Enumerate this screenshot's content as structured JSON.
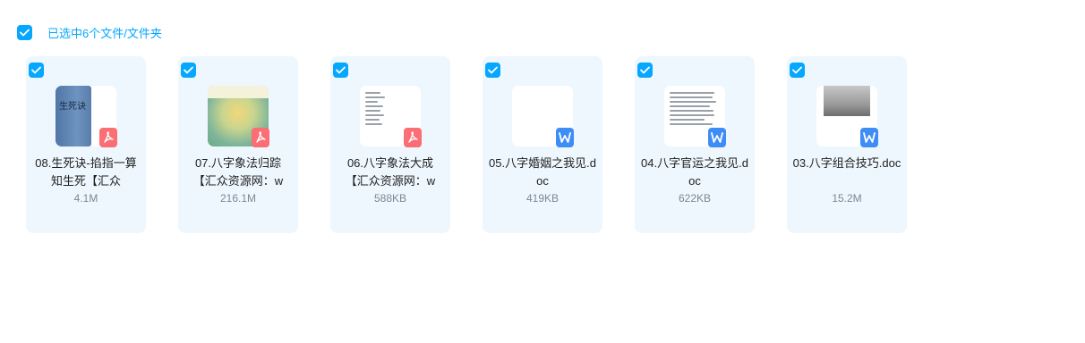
{
  "selection": {
    "text": "已选中6个文件/文件夹"
  },
  "files": [
    {
      "name": "08.生死诀-掐指一算知生死【汇众",
      "size": "4.1M",
      "type": "pdf",
      "badge_icon": "pdf-icon"
    },
    {
      "name": "07.八字象法归踪【汇众资源网：w",
      "size": "216.1M",
      "type": "pdf",
      "badge_icon": "pdf-icon"
    },
    {
      "name": "06.八字象法大成【汇众资源网：w",
      "size": "588KB",
      "type": "pdf",
      "badge_icon": "pdf-icon"
    },
    {
      "name": "05.八字婚姻之我见.doc",
      "size": "419KB",
      "type": "doc",
      "badge_icon": "word-icon"
    },
    {
      "name": "04.八字官运之我见.doc",
      "size": "622KB",
      "type": "doc",
      "badge_icon": "word-icon"
    },
    {
      "name": "03.八字组合技巧.doc",
      "size": "15.2M",
      "type": "doc",
      "badge_icon": "word-icon"
    }
  ],
  "thumbnail_text": {
    "book_cover_title": "生死诀"
  },
  "colors": {
    "accent": "#06a7ff",
    "card_bg": "#eef7fe",
    "pdf_badge": "#fa6e74",
    "doc_badge": "#3e8cf5"
  }
}
